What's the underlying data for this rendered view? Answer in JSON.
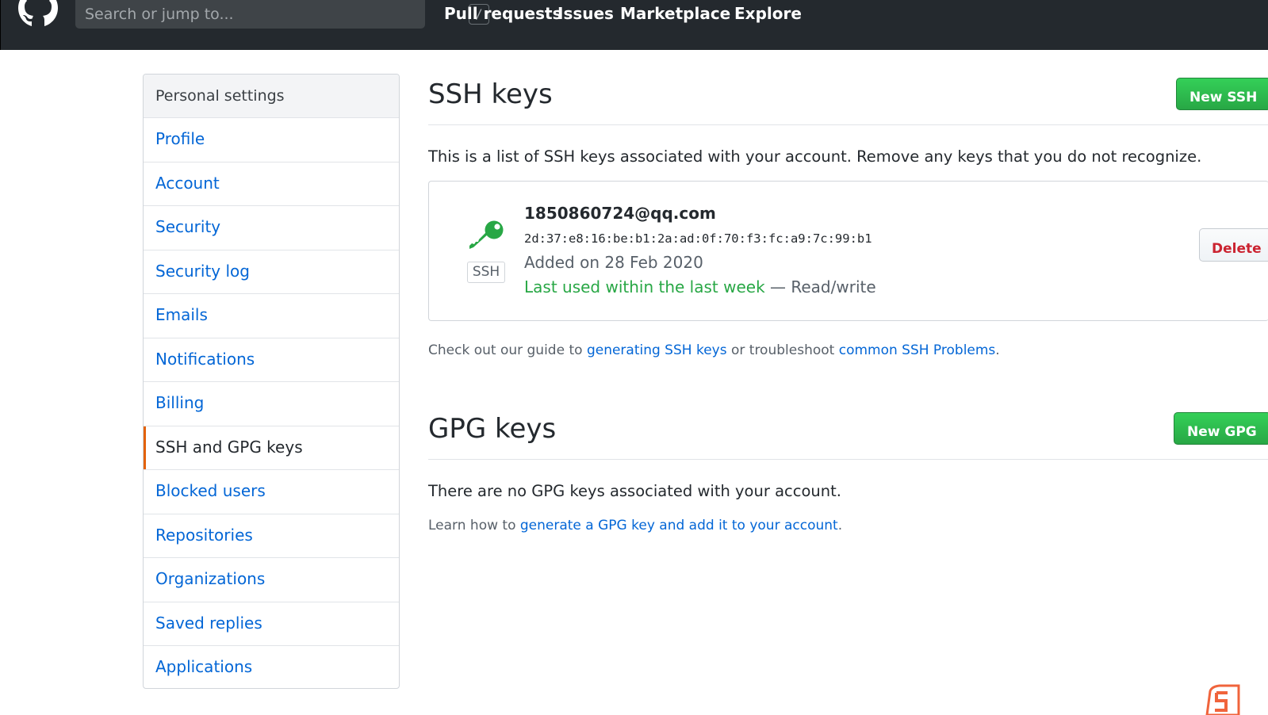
{
  "header": {
    "search": {
      "placeholder": "Search or jump to...",
      "shortcut": "/"
    },
    "nav": [
      "Pull requests",
      "Issues",
      "Marketplace",
      "Explore"
    ]
  },
  "sidebar": {
    "heading": "Personal settings",
    "items": [
      {
        "label": "Profile"
      },
      {
        "label": "Account"
      },
      {
        "label": "Security"
      },
      {
        "label": "Security log"
      },
      {
        "label": "Emails"
      },
      {
        "label": "Notifications"
      },
      {
        "label": "Billing"
      },
      {
        "label": "SSH and GPG keys",
        "selected": true
      },
      {
        "label": "Blocked users"
      },
      {
        "label": "Repositories"
      },
      {
        "label": "Organizations"
      },
      {
        "label": "Saved replies"
      },
      {
        "label": "Applications"
      }
    ]
  },
  "ssh": {
    "title": "SSH keys",
    "new_button": "New SSH",
    "intro": "This is a list of SSH keys associated with your account. Remove any keys that you do not recognize.",
    "key": {
      "badge": "SSH",
      "title": "1850860724@qq.com",
      "fingerprint": "2d:37:e8:16:be:b1:2a:ad:0f:70:f3:fc:a9:7c:99:b1",
      "added": "Added on 28 Feb 2020",
      "last_used": "Last used within the last week",
      "access": "— Read/write",
      "delete_button": "Delete"
    },
    "help": {
      "prefix": "Check out our guide to",
      "link1": "generating SSH keys",
      "middle": "or troubleshoot",
      "link2": "common SSH Problems",
      "suffix": "."
    }
  },
  "gpg": {
    "title": "GPG keys",
    "new_button": "New GPG",
    "empty": "There are no GPG keys associated with your account.",
    "help": {
      "prefix": "Learn how to",
      "link": "generate a GPG key and add it to your account",
      "suffix": "."
    }
  },
  "colors": {
    "header_bg": "#24292e",
    "link": "#0366d6",
    "green": "#28a745",
    "danger": "#cb2431",
    "selected_marker": "#e36209"
  }
}
